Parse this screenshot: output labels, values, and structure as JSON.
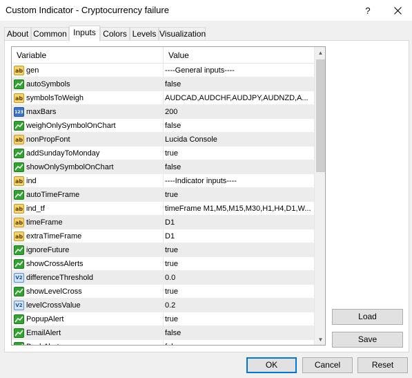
{
  "window": {
    "title": "Custom Indicator - Cryptocurrency failure",
    "help_label": "?"
  },
  "tabs": [
    {
      "label": "About"
    },
    {
      "label": "Common"
    },
    {
      "label": "Inputs",
      "active": true
    },
    {
      "label": "Colors"
    },
    {
      "label": "Levels"
    },
    {
      "label": "Visualization"
    }
  ],
  "grid": {
    "col_variable": "Variable",
    "col_value": "Value",
    "rows": [
      {
        "type": "ab",
        "name": "gen",
        "value": "----General inputs----"
      },
      {
        "type": "bool",
        "name": "autoSymbols",
        "value": "false"
      },
      {
        "type": "ab",
        "name": "symbolsToWeigh",
        "value": "AUDCAD,AUDCHF,AUDJPY,AUDNZD,A..."
      },
      {
        "type": "int",
        "name": "maxBars",
        "value": "200"
      },
      {
        "type": "bool",
        "name": "weighOnlySymbolOnChart",
        "value": "false"
      },
      {
        "type": "ab",
        "name": "nonPropFont",
        "value": "Lucida Console"
      },
      {
        "type": "bool",
        "name": "addSundayToMonday",
        "value": "true"
      },
      {
        "type": "bool",
        "name": "showOnlySymbolOnChart",
        "value": "false"
      },
      {
        "type": "ab",
        "name": "ind",
        "value": "----Indicator inputs----"
      },
      {
        "type": "bool",
        "name": "autoTimeFrame",
        "value": "true"
      },
      {
        "type": "ab",
        "name": "ind_tf",
        "value": "timeFrame M1,M5,M15,M30,H1,H4,D1,W..."
      },
      {
        "type": "ab",
        "name": "timeFrame",
        "value": "D1"
      },
      {
        "type": "ab",
        "name": "extraTimeFrame",
        "value": "D1"
      },
      {
        "type": "bool",
        "name": "ignoreFuture",
        "value": "true"
      },
      {
        "type": "bool",
        "name": "showCrossAlerts",
        "value": "true"
      },
      {
        "type": "dbl",
        "name": "differenceThreshold",
        "value": "0.0"
      },
      {
        "type": "bool",
        "name": "showLevelCross",
        "value": "true"
      },
      {
        "type": "dbl",
        "name": "levelCrossValue",
        "value": "0.2"
      },
      {
        "type": "bool",
        "name": "PopupAlert",
        "value": "true"
      },
      {
        "type": "bool",
        "name": "EmailAlert",
        "value": "false"
      },
      {
        "type": "bool",
        "name": "PushAlert",
        "value": "false"
      }
    ]
  },
  "icon_labels": {
    "ab": "ab",
    "int": "123",
    "dbl": "V2"
  },
  "side_buttons": {
    "load": "Load",
    "save": "Save"
  },
  "footer_buttons": {
    "ok": "OK",
    "cancel": "Cancel",
    "reset": "Reset"
  },
  "colors": {
    "accent": "#0078d7"
  }
}
